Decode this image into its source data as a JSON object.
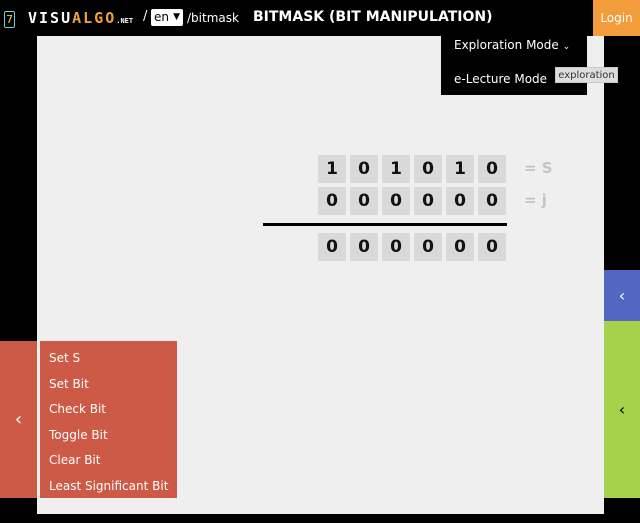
{
  "header": {
    "key_hint": "7",
    "logo_visu": "VISU",
    "logo_algo": "ALGO",
    "logo_net": ".NET",
    "separator": "/",
    "lang_value": "en",
    "path": "/bitmask",
    "title": "BITMASK (BIT MANIPULATION)",
    "login_label": "Login"
  },
  "mode_menu": {
    "exploration": "Exploration Mode",
    "electure": "e-Lecture Mode",
    "tooltip": "exploration"
  },
  "visual": {
    "rows": [
      {
        "bits": [
          "1",
          "0",
          "1",
          "0",
          "1",
          "0"
        ],
        "label": "= S"
      },
      {
        "bits": [
          "0",
          "0",
          "0",
          "0",
          "0",
          "0"
        ],
        "label": "= j"
      },
      {
        "bits": [
          "0",
          "0",
          "0",
          "0",
          "0",
          "0"
        ],
        "label": ""
      }
    ]
  },
  "operations": {
    "items": [
      "Set S",
      "Set Bit",
      "Check Bit",
      "Toggle Bit",
      "Clear Bit",
      "Least Significant Bit"
    ]
  },
  "side": {
    "left_arrow": "‹",
    "right_arrow_1": "‹",
    "right_arrow_2": "‹"
  },
  "colors": {
    "login": "#f39c3c",
    "ops_panel": "#cc5a46",
    "blue_tab": "#5268c0",
    "green_tab": "#a6d14a"
  }
}
